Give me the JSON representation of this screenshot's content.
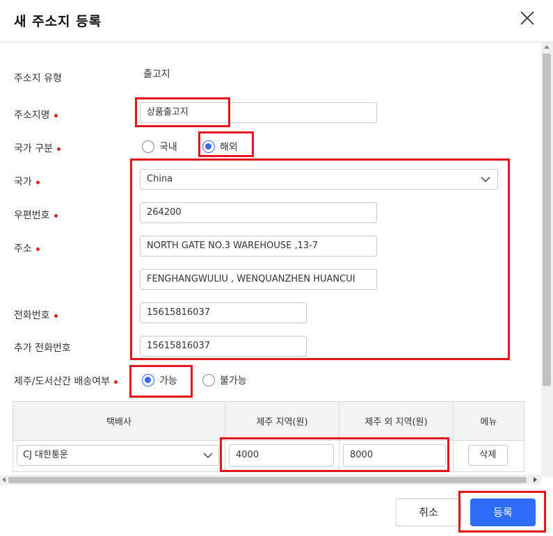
{
  "dialog": {
    "title": "새 주소지 등록"
  },
  "form": {
    "address_type_label": "주소지 유형",
    "address_type_value": "출고지",
    "address_name_label": "주소지명",
    "address_name_value": "상품출고지",
    "country_type_label": "국가 구분",
    "country_type_options": [
      "국내",
      "해외"
    ],
    "country_type_selected": "해외",
    "country_label": "국가",
    "country_value": "China",
    "postal_label": "우편번호",
    "postal_value": "264200",
    "address_label": "주소",
    "address_line1": "NORTH GATE NO.3 WAREHOUSE ,13-7",
    "address_line2": "FENGHANGWULIU , WENQUANZHEN HUANCUI",
    "phone_label": "전화번호",
    "phone_value": "15615816037",
    "extra_phone_label": "추가 전화번호",
    "extra_phone_value": "15615816037",
    "island_label": "제주/도서산간 배송여부",
    "island_options": [
      "가능",
      "불가능"
    ],
    "island_selected": "가능"
  },
  "shipping_table": {
    "headers": [
      "택배사",
      "제주 지역(원)",
      "제주 외 지역(원)",
      "메뉴"
    ],
    "rows": [
      {
        "courier": "CJ 대한통운",
        "jeju": "4000",
        "non_jeju": "8000",
        "delete_label": "삭제"
      }
    ]
  },
  "footer": {
    "cancel_label": "취소",
    "submit_label": "등록"
  },
  "colors": {
    "accent": "#2f6cf6",
    "highlight": "#e3141d",
    "required_dot": "#d9261c"
  }
}
